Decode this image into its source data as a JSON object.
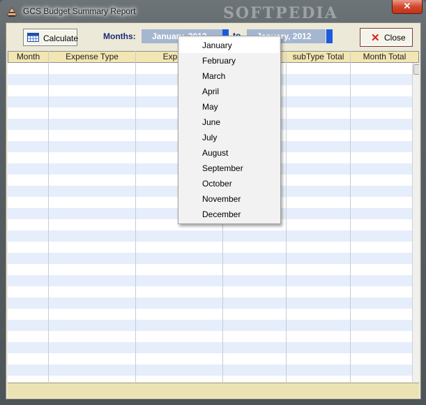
{
  "window": {
    "title": "GCS Budget Summary Report",
    "close_glyph": "✕",
    "watermark": "SOFTPEDIA"
  },
  "toolbar": {
    "calculate_label": "Calculate",
    "months_label": "Months:",
    "from_month": "January, 2012",
    "to_label": "to",
    "to_month": "January, 2012",
    "close_label": "Close"
  },
  "grid": {
    "columns": [
      "Month",
      "Expense Type",
      "Expense",
      "",
      "subType Total",
      "Month Total"
    ]
  },
  "dropdown": {
    "months": [
      "January",
      "February",
      "March",
      "April",
      "May",
      "June",
      "July",
      "August",
      "September",
      "October",
      "November",
      "December"
    ]
  },
  "colors": {
    "header_bg": "#f2e6b3",
    "row_alt": "#e6eefb",
    "field_bg": "#a4b6d0",
    "accent": "#1e5ae0"
  }
}
